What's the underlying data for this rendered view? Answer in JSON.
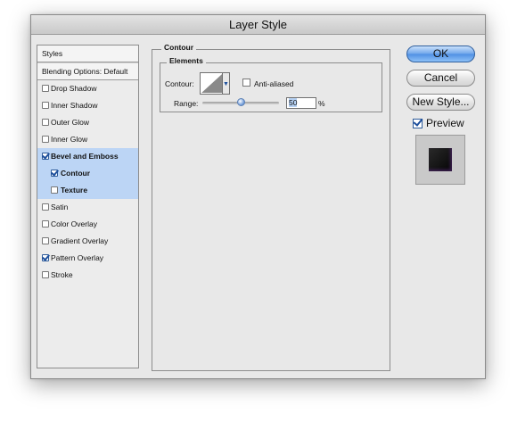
{
  "window": {
    "title": "Layer Style"
  },
  "styles_list": {
    "header": "Styles",
    "blending_options": "Blending Options: Default",
    "items": [
      {
        "label": "Drop Shadow",
        "checked": false
      },
      {
        "label": "Inner Shadow",
        "checked": false
      },
      {
        "label": "Outer Glow",
        "checked": false
      },
      {
        "label": "Inner Glow",
        "checked": false
      },
      {
        "label": "Bevel and Emboss",
        "checked": true
      },
      {
        "label": "Contour",
        "checked": true
      },
      {
        "label": "Texture",
        "checked": false
      },
      {
        "label": "Satin",
        "checked": false
      },
      {
        "label": "Color Overlay",
        "checked": false
      },
      {
        "label": "Gradient Overlay",
        "checked": false
      },
      {
        "label": "Pattern Overlay",
        "checked": true
      },
      {
        "label": "Stroke",
        "checked": false
      }
    ]
  },
  "contour_panel": {
    "title": "Contour",
    "elements_title": "Elements",
    "contour_label": "Contour:",
    "contour_icon": "linear-contour-icon",
    "anti_aliased_label": "Anti-aliased",
    "anti_aliased_checked": false,
    "range_label": "Range:",
    "range_value": "50",
    "range_unit": "%"
  },
  "buttons": {
    "ok": "OK",
    "cancel": "Cancel",
    "new_style": "New Style..."
  },
  "preview": {
    "label": "Preview",
    "checked": true
  },
  "colors": {
    "selection": "#bcd5f5",
    "default_button": "#6ea5ea"
  }
}
